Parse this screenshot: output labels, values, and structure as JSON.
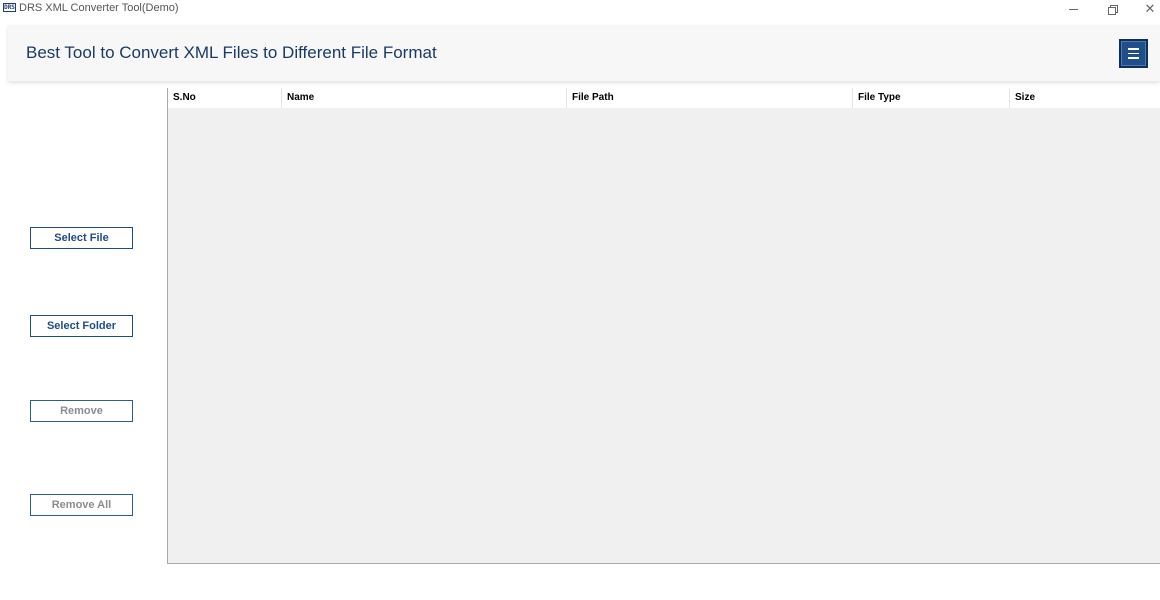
{
  "window": {
    "logo_text": "DRS",
    "title": "DRS XML Converter Tool(Demo)",
    "controls": [
      "minimize-icon",
      "restore-icon",
      "close-icon"
    ],
    "close_glyph": "✕"
  },
  "header": {
    "title": "Best Tool to Convert XML Files to Different File Format",
    "menu_icon": "hamburger-menu-icon",
    "accent_color": "#1f4e8a",
    "title_color": "#1a3a66"
  },
  "sidebar": {
    "buttons": [
      {
        "label": "Select File",
        "enabled": true
      },
      {
        "label": "Select Folder",
        "enabled": true
      },
      {
        "label": "Remove",
        "enabled": false
      },
      {
        "label": "Remove All",
        "enabled": false
      }
    ]
  },
  "table": {
    "columns": [
      "S.No",
      "Name",
      "File Path",
      "File Type",
      "Size"
    ],
    "rows": []
  }
}
